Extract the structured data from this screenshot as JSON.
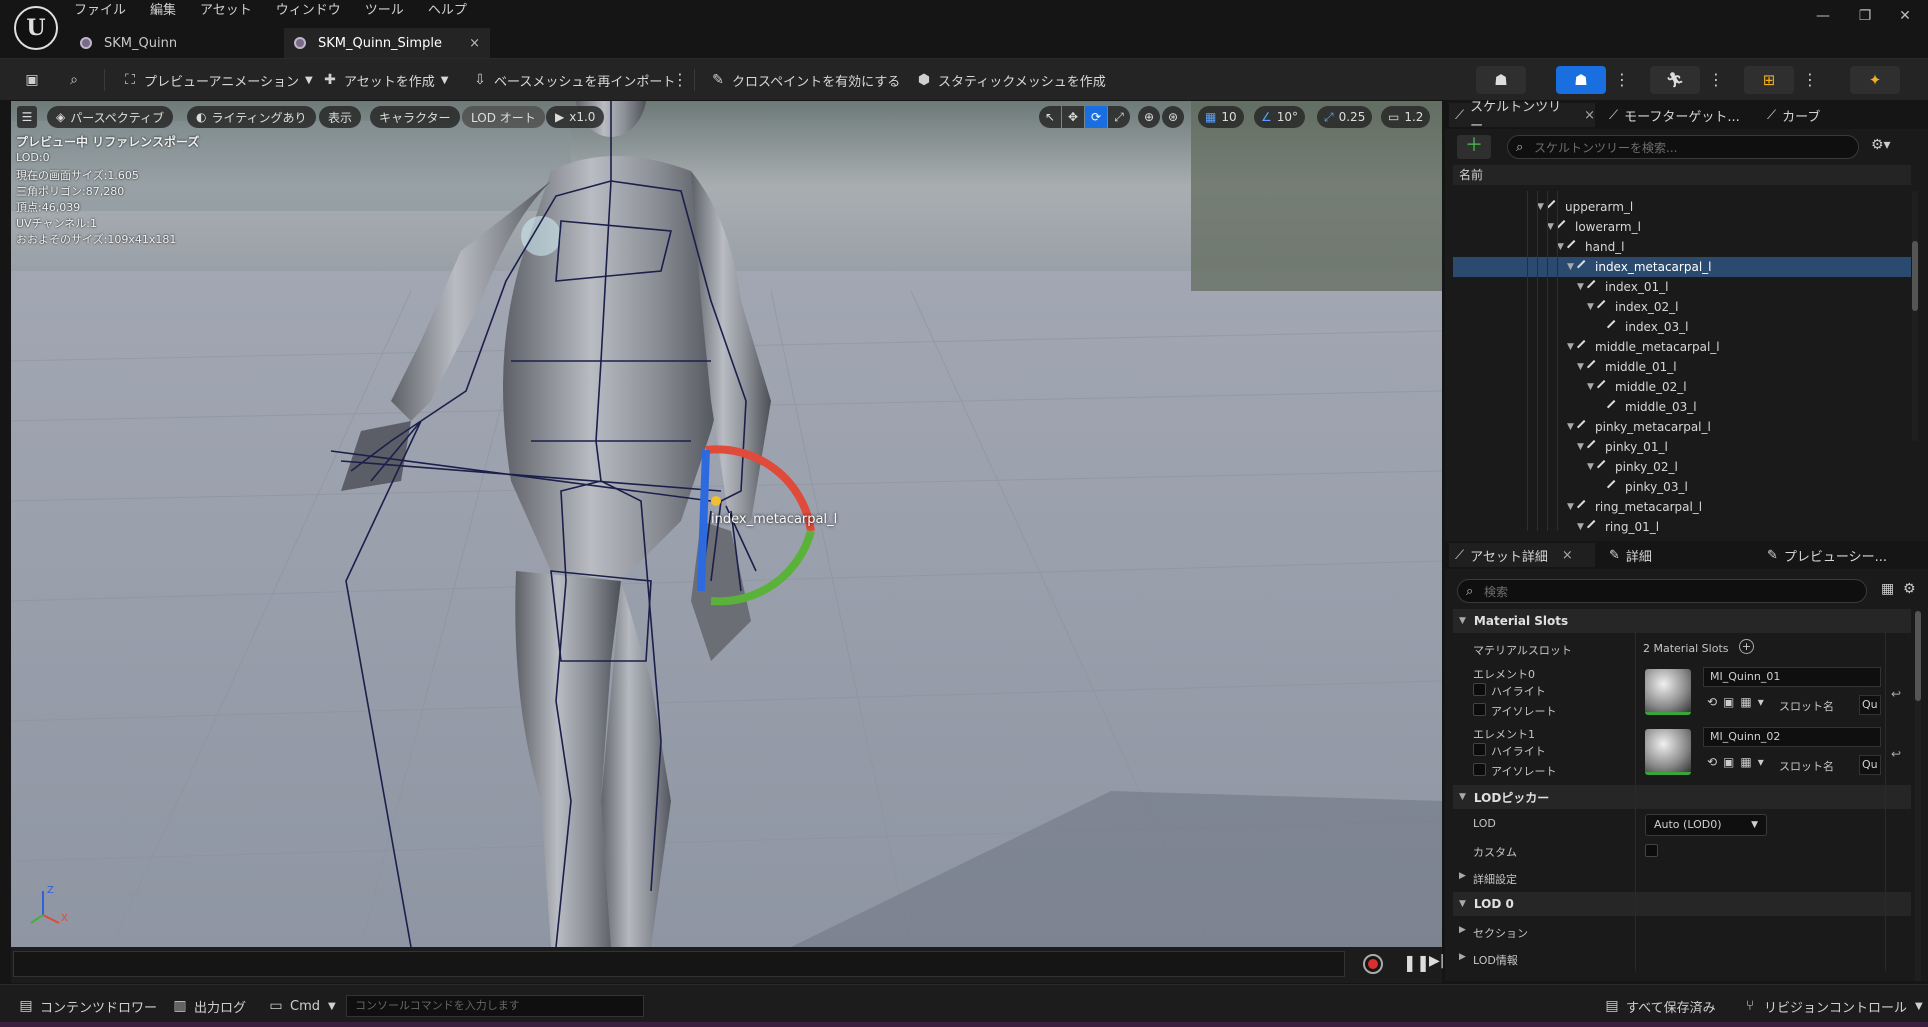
{
  "menu": [
    "ファイル",
    "編集",
    "アセット",
    "ウィンドウ",
    "ツール",
    "ヘルプ"
  ],
  "tabs": [
    {
      "label": "SKM_Quinn",
      "active": false
    },
    {
      "label": "SKM_Quinn_Simple",
      "active": true,
      "close": "×"
    }
  ],
  "window_controls": {
    "minimize": "—",
    "restore": "❐",
    "close": "✕"
  },
  "toolbar": {
    "preview_animation": "プレビューアニメーション",
    "create_asset": "アセットを作成",
    "reimport_base_mesh": "ベースメッシュを再インポート",
    "enable_cloth_paint": "クロスペイントを有効にする",
    "make_static_mesh": "スタティックメッシュを作成"
  },
  "viewport": {
    "perspective": "パースペクティブ",
    "lighting": "ライティングあり",
    "show": "表示",
    "character": "キャラクター",
    "lod_auto": "LOD オート",
    "play_rate": "x1.0",
    "grid_snap": "10",
    "rot_snap": "10°",
    "scale_snap": "0.25",
    "camera_speed": "1.2",
    "stats": [
      "プレビュー中 リファレンスポーズ",
      "LOD:0",
      "現在の画面サイズ:1.605",
      "三角ポリゴン:87,280",
      "頂点:46,039",
      "UVチャンネル:1",
      "おおよそのサイズ:109x41x181"
    ],
    "bone_label": "index_metacarpal_l",
    "axis_z": "Z",
    "axis_x": "X"
  },
  "skeleton_panel": {
    "tabs": [
      "スケルトンツリー",
      "モーフターゲット...",
      "カーブ"
    ],
    "close": "×",
    "search_placeholder": "スケルトンツリーを検索...",
    "column_name": "名前",
    "bones": [
      {
        "name": "upperarm_l",
        "depth": 0,
        "expander": "▼"
      },
      {
        "name": "lowerarm_l",
        "depth": 1,
        "expander": "▼"
      },
      {
        "name": "hand_l",
        "depth": 2,
        "expander": "▼"
      },
      {
        "name": "index_metacarpal_l",
        "depth": 3,
        "expander": "▼",
        "selected": true
      },
      {
        "name": "index_01_l",
        "depth": 4,
        "expander": "▼"
      },
      {
        "name": "index_02_l",
        "depth": 5,
        "expander": "▼"
      },
      {
        "name": "index_03_l",
        "depth": 6,
        "expander": ""
      },
      {
        "name": "middle_metacarpal_l",
        "depth": 3,
        "expander": "▼"
      },
      {
        "name": "middle_01_l",
        "depth": 4,
        "expander": "▼"
      },
      {
        "name": "middle_02_l",
        "depth": 5,
        "expander": "▼"
      },
      {
        "name": "middle_03_l",
        "depth": 6,
        "expander": ""
      },
      {
        "name": "pinky_metacarpal_l",
        "depth": 3,
        "expander": "▼"
      },
      {
        "name": "pinky_01_l",
        "depth": 4,
        "expander": "▼"
      },
      {
        "name": "pinky_02_l",
        "depth": 5,
        "expander": "▼"
      },
      {
        "name": "pinky_03_l",
        "depth": 6,
        "expander": ""
      },
      {
        "name": "ring_metacarpal_l",
        "depth": 3,
        "expander": "▼"
      },
      {
        "name": "ring_01_l",
        "depth": 4,
        "expander": "▼"
      }
    ]
  },
  "details_panel": {
    "tabs": [
      "アセット詳細",
      "詳細",
      "プレビューシー..."
    ],
    "close": "×",
    "search_placeholder": "検索",
    "material_slots_header": "Material Slots",
    "material_slot_label": "マテリアルスロット",
    "material_slot_count": "2 Material Slots",
    "elements": [
      {
        "label": "エレメント0",
        "highlight": "ハイライト",
        "isolate": "アイソレート",
        "material": "MI_Quinn_01",
        "slot_label": "スロット名",
        "slot_value": "Qu"
      },
      {
        "label": "エレメント1",
        "highlight": "ハイライト",
        "isolate": "アイソレート",
        "material": "MI_Quinn_02",
        "slot_label": "スロット名",
        "slot_value": "Qu"
      }
    ],
    "lod_picker_header": "LODピッカー",
    "lod_label": "LOD",
    "lod_value": "Auto (LOD0)",
    "custom_label": "カスタム",
    "advanced_label": "詳細設定",
    "lod0_header": "LOD 0",
    "sections_label": "セクション",
    "lod_info_label": "LOD情報"
  },
  "statusbar": {
    "content_drawer": "コンテンツドロワー",
    "output_log": "出力ログ",
    "cmd": "Cmd",
    "console_placeholder": "コンソールコマンドを入力します",
    "all_saved": "すべて保存済み",
    "revision_control": "リビジョンコントロール"
  },
  "colors": {
    "accent": "#1a6fe0",
    "selection": "#2b4a70",
    "background": "#151515",
    "panel": "#1a1a1a"
  }
}
